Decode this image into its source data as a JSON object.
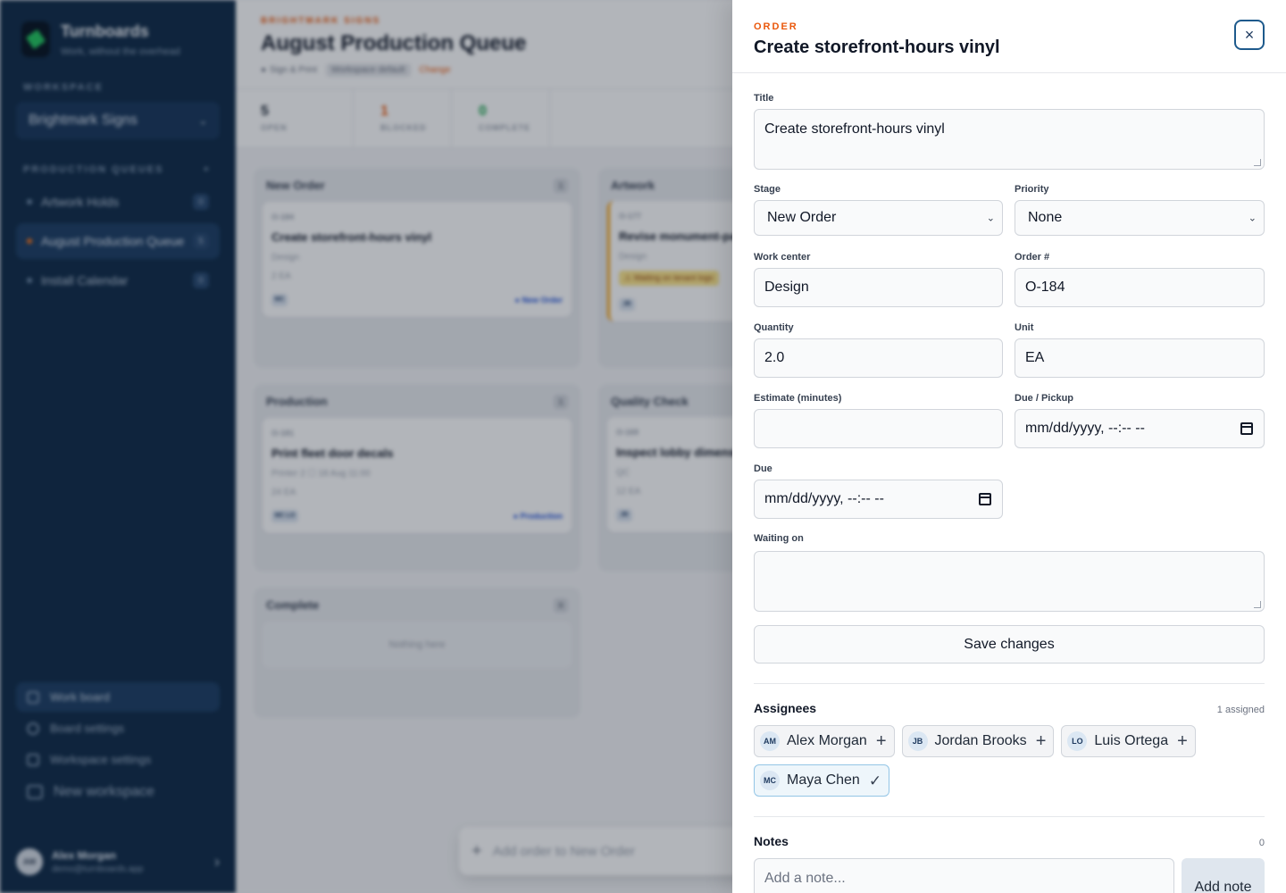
{
  "sidebar": {
    "brand_name": "Turnboards",
    "brand_tagline": "Work, without the overhead",
    "workspace_label": "WORKSPACE",
    "workspace_value": "Brightmark Signs",
    "queues_label": "PRODUCTION QUEUES",
    "queues_add": "+",
    "queues": [
      {
        "name": "Artwork Holds",
        "count": "0"
      },
      {
        "name": "August Production Queue",
        "count": "5"
      },
      {
        "name": "Install Calendar",
        "count": "0"
      }
    ],
    "links": {
      "work_board": "Work board",
      "board_settings": "Board settings",
      "workspace_settings": "Workspace settings",
      "new_workspace": "New workspace"
    },
    "user": {
      "initials": "AM",
      "name": "Alex Morgan",
      "email": "demo@turnboards.app"
    }
  },
  "main": {
    "crumb": "BRIGHTMARK SIGNS",
    "title": "August Production Queue",
    "meta_group": "Sign & Print",
    "meta_pill": "Workspace default",
    "meta_change": "Change",
    "stats": [
      {
        "value": "5",
        "label": "OPEN"
      },
      {
        "value": "1",
        "label": "BLOCKED"
      },
      {
        "value": "0",
        "label": "COMPLETE"
      }
    ],
    "columns": {
      "new_order": {
        "title": "New Order",
        "count": "1"
      },
      "artwork": {
        "title": "Artwork"
      },
      "production": {
        "title": "Production",
        "count": "1"
      },
      "quality": {
        "title": "Quality Check"
      },
      "complete": {
        "title": "Complete",
        "count": "0",
        "empty": "Nothing here"
      }
    },
    "cards": {
      "c1": {
        "id": "O-184",
        "title": "Create storefront-hours vinyl",
        "meta": "Design",
        "qty": "2 EA",
        "avatars": "MC",
        "stage": "● New Order"
      },
      "c2": {
        "id": "O-177",
        "title": "Revise monument-panel proof",
        "meta": "Design",
        "warn": "⚠ Waiting on tenant logo",
        "avatars": "JB"
      },
      "c3": {
        "id": "O-181",
        "title": "Print fleet door decals",
        "meta": "Printer 2   ☐ 18 Aug 11:00",
        "qty": "24 EA",
        "avatars": "MC LO",
        "stage": "● Production"
      },
      "c4": {
        "id": "O-169",
        "title": "Inspect lobby dimensional letters",
        "meta": "QC",
        "qty": "12 EA",
        "avatars": "JB"
      }
    },
    "add_order": "Add order to New Order"
  },
  "drawer": {
    "eyebrow": "ORDER",
    "title": "Create storefront-hours vinyl",
    "close": "×",
    "fields": {
      "title_label": "Title",
      "title_value": "Create storefront-hours vinyl",
      "stage_label": "Stage",
      "stage_value": "New Order",
      "priority_label": "Priority",
      "priority_value": "None",
      "work_center_label": "Work center",
      "work_center_value": "Design",
      "order_label": "Order #",
      "order_value": "O-184",
      "quantity_label": "Quantity",
      "quantity_value": "2.0",
      "unit_label": "Unit",
      "unit_value": "EA",
      "estimate_label": "Estimate (minutes)",
      "estimate_value": "",
      "due_pickup_label": "Due / Pickup",
      "due_pickup_placeholder": "mm/dd/yyyy, --:-- --",
      "due_label": "Due",
      "due_placeholder": "mm/dd/yyyy, --:-- --",
      "waiting_label": "Waiting on",
      "waiting_value": ""
    },
    "save_label": "Save changes",
    "assignees": {
      "title": "Assignees",
      "count": "1 assigned",
      "people": [
        {
          "initials": "AM",
          "name": "Alex Morgan",
          "assigned": false,
          "action": "+"
        },
        {
          "initials": "JB",
          "name": "Jordan Brooks",
          "assigned": false,
          "action": "+"
        },
        {
          "initials": "LO",
          "name": "Luis Ortega",
          "assigned": false,
          "action": "+"
        },
        {
          "initials": "MC",
          "name": "Maya Chen",
          "assigned": true,
          "action": "✓"
        }
      ]
    },
    "notes": {
      "title": "Notes",
      "count": "0",
      "placeholder": "Add a note...",
      "add_label": "Add note"
    }
  }
}
